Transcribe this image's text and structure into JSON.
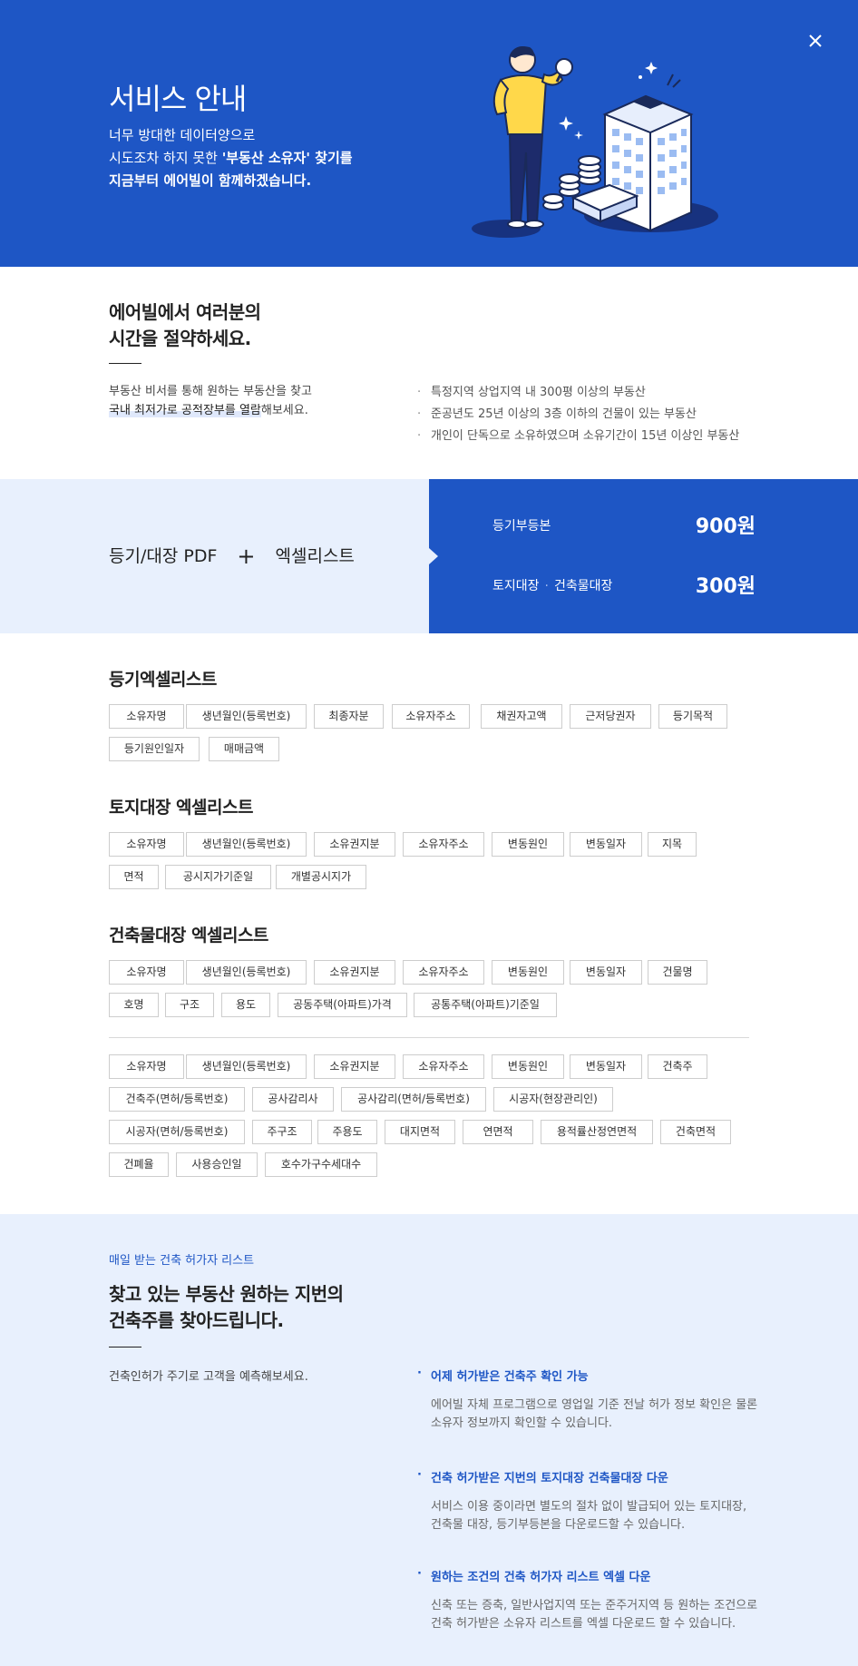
{
  "hero": {
    "title": "서비스 안내",
    "desc_line1": "너무 방대한 데이터양으로",
    "desc_line2_pre": "시도조차 하지 못한 ",
    "desc_line2_bold": "'부동산 소유자' 찾기를",
    "desc_line3": "지금부터 에어빌이 함께하겠습니다.",
    "close_icon": "close-icon",
    "colors": {
      "primary": "#1e56c5",
      "light": "#e8f0fd"
    }
  },
  "save": {
    "title_line1": "에어빌에서 여러분의",
    "title_line2": "시간을 절약하세요.",
    "desc_line1": "부동산 비서를 통해 원하는 부동산을 찾고",
    "desc_line2_hl": "국내 최저가로 공적장부를 열람",
    "desc_line2_rest": "해보세요.",
    "bullets": [
      "특정지역 상업지역 내 300평 이상의 부동산",
      "준공년도 25년 이상의 3층 이하의 건물이 있는 부동산",
      "개인이 단독으로 소유하였으며 소유기간이 15년 이상인 부동산"
    ]
  },
  "price": {
    "left_a": "등기/대장 PDF",
    "plus": "+",
    "left_b": "엑셀리스트",
    "rows": [
      {
        "name_a": "등기부등본",
        "name_b": "",
        "value": "900원"
      },
      {
        "name_a": "토지대장",
        "sep": "·",
        "name_b": "건축물대장",
        "value": "300원"
      }
    ]
  },
  "registry": {
    "title": "등기엑셀리스트",
    "row1": [
      "소유자명",
      "생년월인(등록번호)",
      "최종자분",
      "소유자주소",
      "채권자고액",
      "근저당권자",
      "등기목적"
    ],
    "row2": [
      "등기원인일자",
      "매매금액"
    ]
  },
  "land": {
    "title": "토지대장 엑셀리스트",
    "row1": [
      "소유자명",
      "생년월인(등록번호)",
      "소유권지분",
      "소유자주소",
      "변동원인",
      "변동일자",
      "지목"
    ],
    "row2": [
      "면적",
      "공시지가기준일",
      "개별공시지가"
    ]
  },
  "building": {
    "title": "건축물대장 엑셀리스트",
    "row1": [
      "소유자명",
      "생년월인(등록번호)",
      "소유권지분",
      "소유자주소",
      "변동원인",
      "변동일자",
      "건물명"
    ],
    "row2": [
      "호명",
      "구조",
      "용도",
      "공동주택(아파트)가격",
      "공통주택(아파트)기준일"
    ],
    "row3": [
      "소유자명",
      "생년월인(등록번호)",
      "소유권지분",
      "소유자주소",
      "변동원인",
      "변동일자",
      "건축주"
    ],
    "row4": [
      "건축주(면허/등록번호)",
      "공사감리사",
      "공사감리(면허/등록번호)",
      "시공자(현장관리인)"
    ],
    "row5": [
      "시공자(면허/등록번호)",
      "주구조",
      "주용도",
      "대지면적",
      "연면적",
      "용적률산정연면적",
      "건축면적"
    ],
    "row6": [
      "건폐율",
      "사용승인일",
      "호수가구수세대수"
    ]
  },
  "permit": {
    "eyebrow": "매일 받는 건축 허가자 리스트",
    "title_line1": "찾고 있는 부동산 원하는 지번의",
    "title_line2": "건축주를 찾아드립니다.",
    "desc": "건축인허가 주기로 고객을 예측해보세요.",
    "features": [
      {
        "head": "어제 허가받은 건축주 확인 가능",
        "body1": "에어빌 자체 프로그램으로 영업일 기준 전날 허가 정보 확인은 물론",
        "body2": "소유자 정보까지 확인할 수 있습니다."
      },
      {
        "head": "건축 허가받은 지번의 토지대장 건축물대장 다운",
        "body1": "서비스 이용 중이라면 별도의 절차 없이 발급되어 있는 토지대장,",
        "body2": "건축물 대장, 등기부등본을 다운로드할 수 있습니다."
      },
      {
        "head": "원하는 조건의 건축 허가자 리스트 엑셀 다운",
        "body1": "신축 또는 증축, 일반사업지역 또는 준주거지역 등 원하는 조건으로",
        "body2": "건축 허가받은 소유자 리스트를 엑셀 다운로드 할 수 있습니다."
      }
    ]
  }
}
